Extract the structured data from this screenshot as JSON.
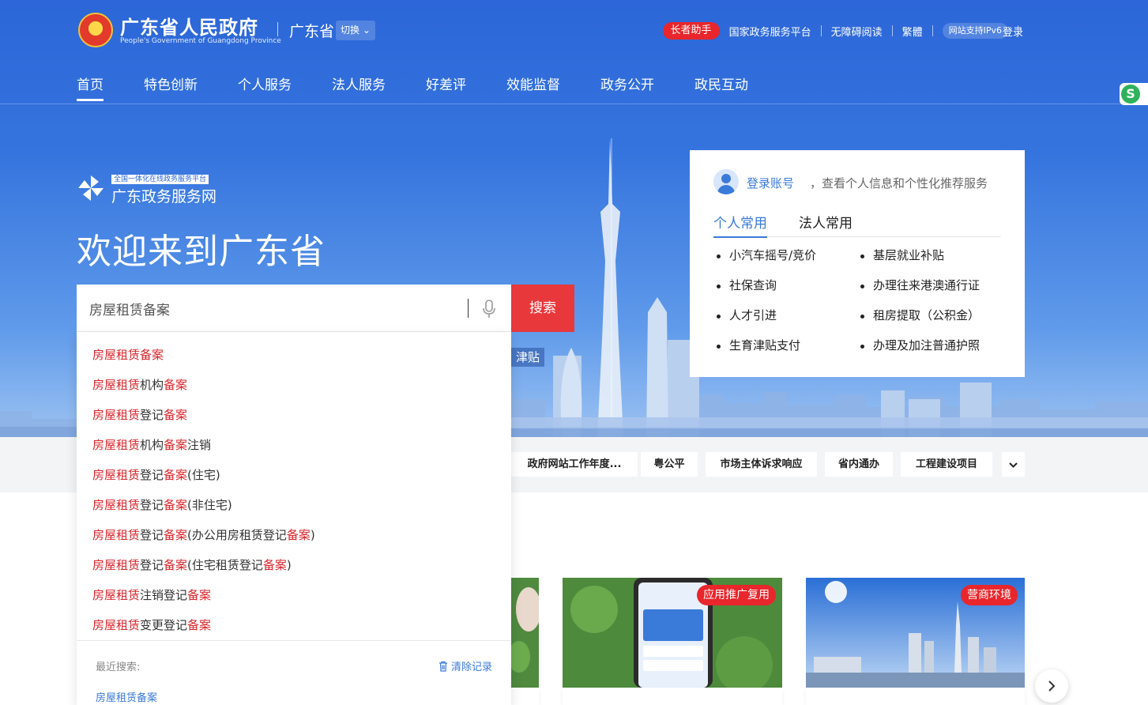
{
  "header": {
    "gov_title": "广东省人民政府",
    "gov_subtitle": "People's Government of Guangdong Province",
    "province": "广东省",
    "switch_label": "切换",
    "utility_links": [
      "长者助手",
      "国家政务服务平台",
      "无障碍阅读",
      "繁體",
      "网站支持IPv6"
    ],
    "login": "登录"
  },
  "main_nav": [
    "首页",
    "特色创新",
    "个人服务",
    "法人服务",
    "好差评",
    "效能监督",
    "政务公开",
    "政民互动"
  ],
  "platform": {
    "tag": "全国一体化在线政务服务平台",
    "name": "广东政务服务网"
  },
  "welcome": "欢迎来到广东省",
  "search": {
    "value": "房屋租赁备案",
    "button": "搜索",
    "hint_tag": "津贴",
    "suggestions": [
      [
        {
          "t": "房屋租赁备案",
          "h": true
        }
      ],
      [
        {
          "t": "房屋租赁",
          "h": true
        },
        {
          "t": "机构",
          "h": false
        },
        {
          "t": "备案",
          "h": true
        }
      ],
      [
        {
          "t": "房屋租赁",
          "h": true
        },
        {
          "t": "登记",
          "h": false
        },
        {
          "t": "备案",
          "h": true
        }
      ],
      [
        {
          "t": "房屋租赁",
          "h": true
        },
        {
          "t": "机构",
          "h": false
        },
        {
          "t": "备案",
          "h": true
        },
        {
          "t": "注销",
          "h": false
        }
      ],
      [
        {
          "t": "房屋租赁",
          "h": true
        },
        {
          "t": "登记",
          "h": false
        },
        {
          "t": "备案",
          "h": true
        },
        {
          "t": "(住宅)",
          "h": false
        }
      ],
      [
        {
          "t": "房屋租赁",
          "h": true
        },
        {
          "t": "登记",
          "h": false
        },
        {
          "t": "备案",
          "h": true
        },
        {
          "t": "(非住宅)",
          "h": false
        }
      ],
      [
        {
          "t": "房屋租赁",
          "h": true
        },
        {
          "t": "登记",
          "h": false
        },
        {
          "t": "备案",
          "h": true
        },
        {
          "t": "(办公用房租赁登记",
          "h": false
        },
        {
          "t": "备案",
          "h": true
        },
        {
          "t": ")",
          "h": false
        }
      ],
      [
        {
          "t": "房屋租赁",
          "h": true
        },
        {
          "t": "登记",
          "h": false
        },
        {
          "t": "备案",
          "h": true
        },
        {
          "t": "(住宅租赁登记",
          "h": false
        },
        {
          "t": "备案",
          "h": true
        },
        {
          "t": ")",
          "h": false
        }
      ],
      [
        {
          "t": "房屋租赁",
          "h": true
        },
        {
          "t": "注销登记",
          "h": false
        },
        {
          "t": "备案",
          "h": true
        }
      ],
      [
        {
          "t": "房屋租赁",
          "h": true
        },
        {
          "t": "变更登记",
          "h": false
        },
        {
          "t": "备案",
          "h": true
        }
      ]
    ],
    "recent_label": "最近搜索:",
    "clear_label": "清除记录",
    "recent_items": [
      "房屋租赁备案"
    ]
  },
  "login_card": {
    "login_link": "登录账号",
    "description": "，查看个人信息和个性化推荐服务",
    "tabs": [
      "个人常用",
      "法人常用"
    ],
    "services": [
      "小汽车摇号/竞价",
      "基层就业补贴",
      "社保查询",
      "办理往来港澳通行证",
      "人才引进",
      "租房提取（公积金）",
      "生育津贴支付",
      "办理及加注普通护照"
    ]
  },
  "tags": [
    "政府网站工作年度...",
    "粤公平",
    "市场主体诉求响应",
    "省内通办",
    "工程建设项目"
  ],
  "feature_cards": [
    {
      "badge": "应用推广复用"
    },
    {
      "badge": "营商环境"
    }
  ],
  "colors": {
    "brand_blue": "#2c66d8",
    "accent_red": "#e8383c",
    "link_blue": "#3a7ad8"
  }
}
